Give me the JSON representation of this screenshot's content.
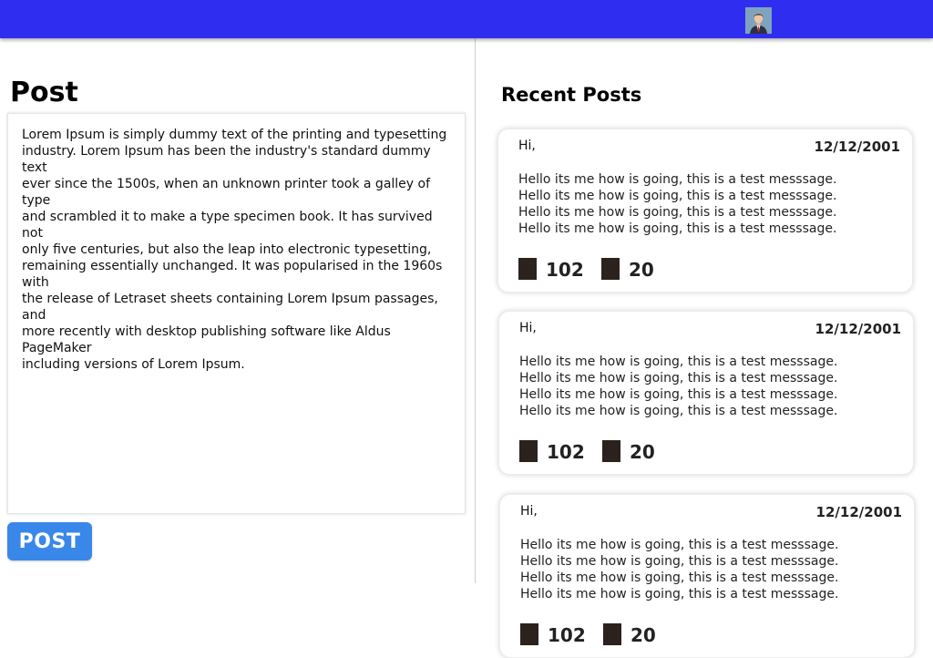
{
  "header": {
    "avatar": "user-avatar-icon",
    "accent_color": "#2f2ef0"
  },
  "post_editor": {
    "title": "Post",
    "content": "Lorem Ipsum is simply dummy text of the printing and typesetting\nindustry. Lorem Ipsum has been the industry's standard dummy text\never since the 1500s, when an unknown printer took a galley of type\nand scrambled it to make a type specimen book. It has survived not\nonly five centuries, but also the leap into electronic typesetting,\nremaining essentially unchanged. It was popularised in the 1960s with\nthe release of Letraset sheets containing Lorem Ipsum passages, and\nmore recently with desktop publishing software like Aldus PageMaker\nincluding versions of Lorem Ipsum.",
    "post_button_label": "POST",
    "post_button_color": "#3a87ea"
  },
  "recent": {
    "title": "Recent Posts",
    "posts": [
      {
        "greeting": "Hi,",
        "date": "12/12/2001",
        "lines": [
          "Hello its me how is going, this is a test messsage.",
          "Hello its me how is going, this is a test messsage.",
          "Hello its me how is going, this is a test messsage.",
          "Hello its me how is going, this is a test messsage."
        ],
        "stat1_icon": "square-icon",
        "stat1": "102",
        "stat2_icon": "square-icon",
        "stat2": "20"
      },
      {
        "greeting": "Hi,",
        "date": "12/12/2001",
        "lines": [
          "Hello its me how is going, this is a test messsage.",
          "Hello its me how is going, this is a test messsage.",
          "Hello its me how is going, this is a test messsage.",
          "Hello its me how is going, this is a test messsage."
        ],
        "stat1_icon": "square-icon",
        "stat1": "102",
        "stat2_icon": "square-icon",
        "stat2": "20"
      },
      {
        "greeting": "Hi,",
        "date": "12/12/2001",
        "lines": [
          "Hello its me how is going, this is a test messsage.",
          "Hello its me how is going, this is a test messsage.",
          "Hello its me how is going, this is a test messsage.",
          "Hello its me how is going, this is a test messsage."
        ],
        "stat1_icon": "square-icon",
        "stat1": "102",
        "stat2_icon": "square-icon",
        "stat2": "20"
      }
    ]
  }
}
